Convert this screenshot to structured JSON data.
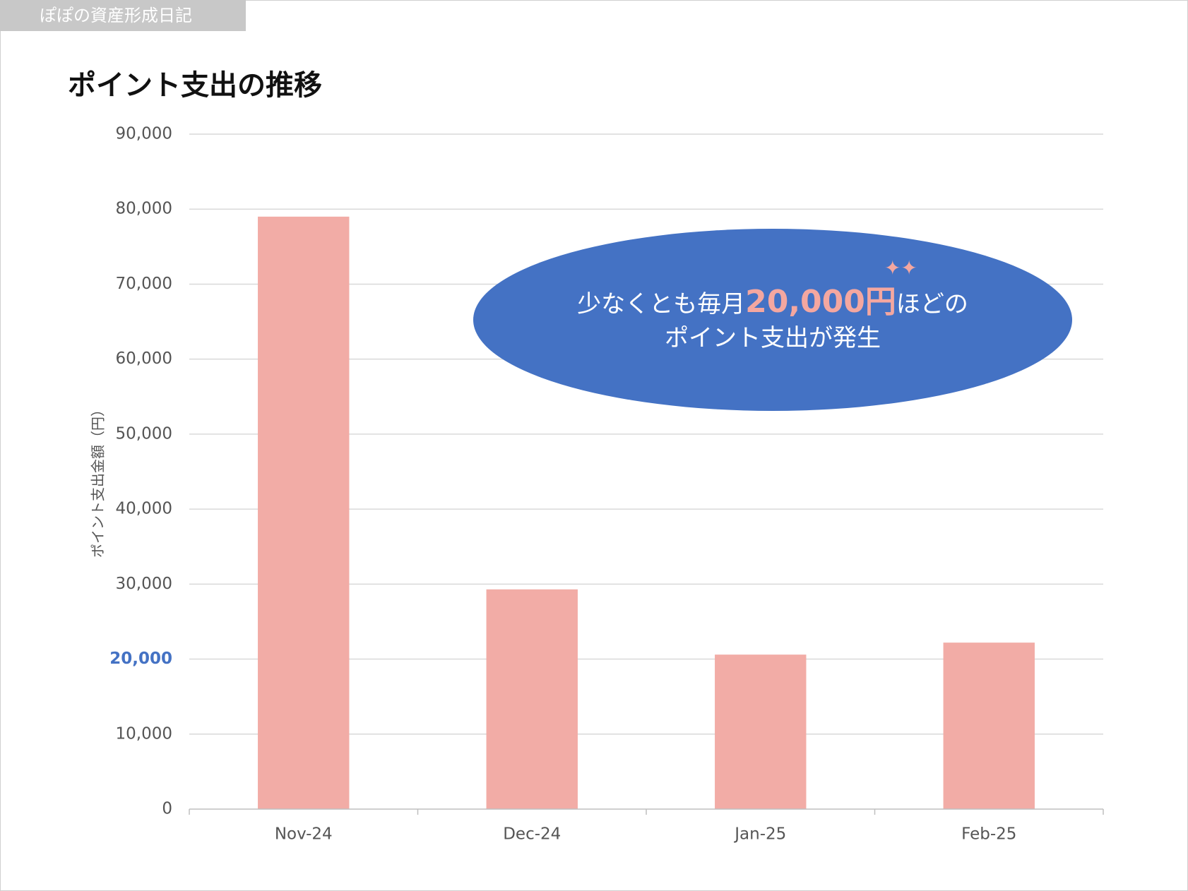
{
  "header": {
    "blog_name": "ぽぽの資産形成日記"
  },
  "chart_data": {
    "type": "bar",
    "title": "ポイント支出の推移",
    "ylabel": "ポイント支出金額（円）",
    "xlabel": "",
    "categories": [
      "Nov-24",
      "Dec-24",
      "Jan-25",
      "Feb-25"
    ],
    "values": [
      79000,
      29300,
      20600,
      22200
    ],
    "ylim": [
      0,
      90000
    ],
    "yticks": [
      "0",
      "10,000",
      "20,000",
      "30,000",
      "40,000",
      "50,000",
      "60,000",
      "70,000",
      "80,000",
      "90,000"
    ],
    "highlight_tick": "20,000",
    "bar_color": "#f2aca6",
    "grid": true,
    "legend": "none"
  },
  "callout": {
    "prefix": "少なくとも毎月",
    "amount": "20,000円",
    "suffix": "ほどの",
    "line2": "ポイント支出が発生",
    "ellipse_color": "#4472c4",
    "highlight_color": "#f4a7a0",
    "sparkle": "✦✦"
  }
}
